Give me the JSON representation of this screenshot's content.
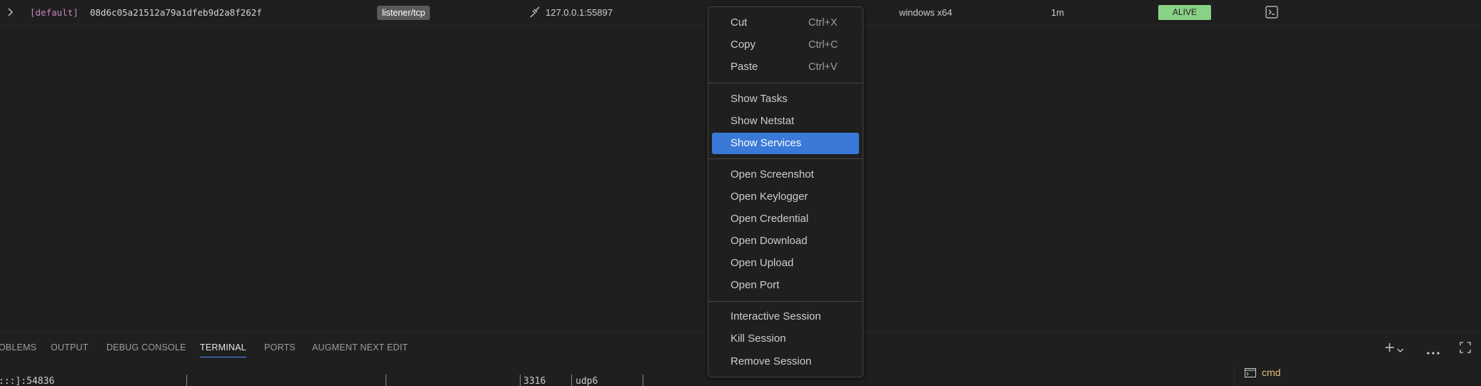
{
  "session": {
    "namespace": "[default]",
    "id": "08d6c05a21512a79a1dfeb9d2a8f262f",
    "listener": "listener/tcp",
    "address": "127.0.0.1:55897",
    "os": "windows x64",
    "last_seen": "1m",
    "status": "ALIVE",
    "status_color": "#89d185",
    "icons": {
      "expand": "chevron-right-icon",
      "connection": "disconnect-icon",
      "terminal": "terminal-icon"
    }
  },
  "menu": {
    "items": [
      {
        "label": "Cut",
        "shortcut": "Ctrl+X"
      },
      {
        "label": "Copy",
        "shortcut": "Ctrl+C"
      },
      {
        "label": "Paste",
        "shortcut": "Ctrl+V"
      },
      {
        "label": "Show Tasks"
      },
      {
        "label": "Show Netstat"
      },
      {
        "label": "Show Services",
        "highlighted": true
      },
      {
        "label": "Open Screenshot"
      },
      {
        "label": "Open Keylogger"
      },
      {
        "label": "Open Credential"
      },
      {
        "label": "Open Download"
      },
      {
        "label": "Open Upload"
      },
      {
        "label": "Open Port"
      },
      {
        "label": "Interactive Session"
      },
      {
        "label": "Kill Session"
      },
      {
        "label": "Remove Session"
      }
    ],
    "highlight_color": "#3a79d7"
  },
  "panel": {
    "tabs": [
      {
        "label": "OBLEMS"
      },
      {
        "label": "OUTPUT"
      },
      {
        "label": "DEBUG CONSOLE"
      },
      {
        "label": "TERMINAL",
        "active": true
      },
      {
        "label": "PORTS"
      },
      {
        "label": "AUGMENT NEXT EDIT"
      }
    ],
    "terminal_output": [
      ":::]:54836",
      "3316",
      "udp6"
    ],
    "terminal_list": [
      {
        "name": "cmd",
        "icon": "terminal-cmd-icon"
      }
    ],
    "actions": [
      "plus-icon",
      "chevron-down-icon",
      "ellipsis-icon",
      "maximize-icon"
    ]
  }
}
